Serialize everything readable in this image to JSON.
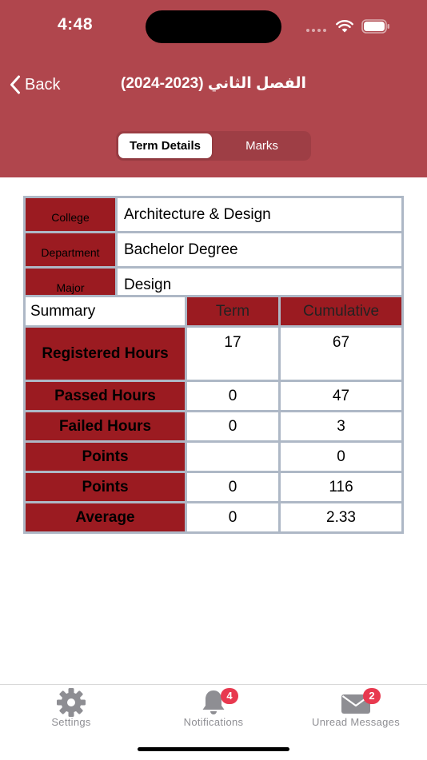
{
  "status_bar": {
    "time": "4:48"
  },
  "nav": {
    "back_label": "Back",
    "title": "الفصل الثاني (2023-2024)"
  },
  "segmented": {
    "tabs": [
      "Term Details",
      "Marks"
    ],
    "selected": "Term Details"
  },
  "info": [
    {
      "label": "College",
      "value": "Architecture & Design"
    },
    {
      "label": "Department",
      "value": "Bachelor Degree"
    },
    {
      "label": "Major",
      "value": "Design"
    }
  ],
  "summary": {
    "headers": [
      "Summary",
      "Term",
      "Cumulative"
    ],
    "rows": [
      {
        "label": "Registered Hours",
        "term": "17",
        "cumulative": "67"
      },
      {
        "label": "Passed Hours",
        "term": "0",
        "cumulative": "47"
      },
      {
        "label": "Failed Hours",
        "term": "0",
        "cumulative": "3"
      },
      {
        "label": "Points",
        "term": "",
        "cumulative": "0"
      },
      {
        "label": "Points",
        "term": "0",
        "cumulative": "116"
      },
      {
        "label": "Average",
        "term": "0",
        "cumulative": "2.33"
      }
    ]
  },
  "tabbar": {
    "items": [
      {
        "label": "Settings",
        "icon": "gear-icon",
        "badge": ""
      },
      {
        "label": "Notifications",
        "icon": "bell-icon",
        "badge": "4"
      },
      {
        "label": "Unread Messages",
        "icon": "envelope-icon",
        "badge": "2"
      }
    ]
  },
  "colors": {
    "header_bg": "#b0464d",
    "cell_red": "#9b1b21",
    "grid": "#aeb8c6",
    "badge": "#e8394f",
    "tab_inactive": "#8e8e93"
  }
}
